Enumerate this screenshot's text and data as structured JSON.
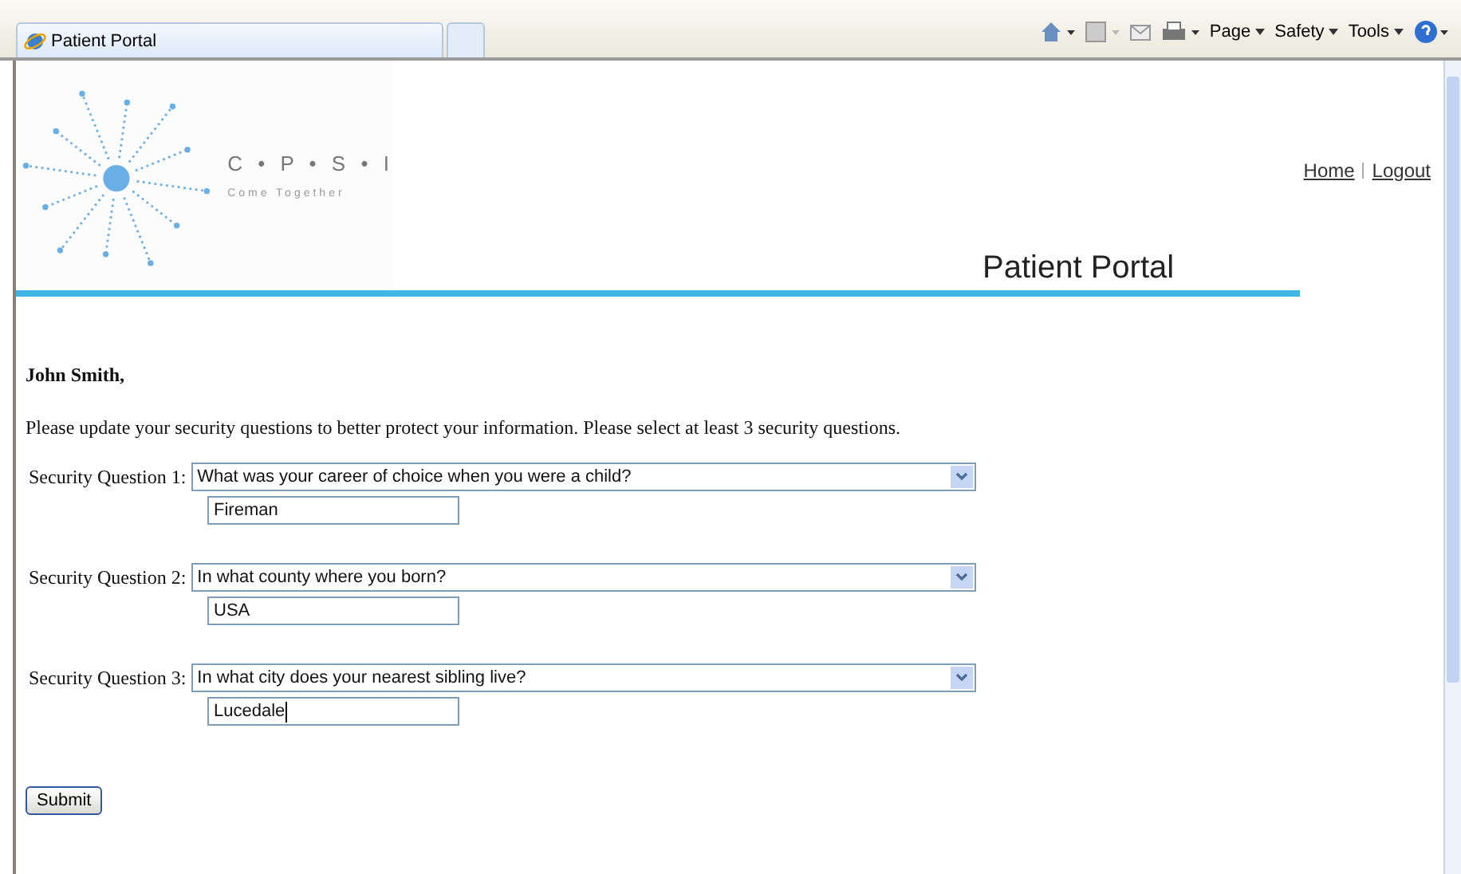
{
  "browser": {
    "tabs": [
      {
        "title": "Patient Portal",
        "selected": true
      },
      {
        "selected": false
      }
    ],
    "toolbar": [
      {
        "kind": "home"
      },
      {
        "kind": "feeds"
      },
      {
        "kind": "mail"
      },
      {
        "kind": "print"
      },
      {
        "kind": "menu",
        "label": "Page"
      },
      {
        "kind": "menu",
        "label": "Safety"
      },
      {
        "kind": "menu",
        "label": "Tools"
      },
      {
        "kind": "help"
      }
    ]
  },
  "logo": {
    "name": "C • P • S • I",
    "tagline": "Come Together"
  },
  "nav": [
    "Home",
    "Logout"
  ],
  "page_title": "Patient Portal",
  "greeting": "John Smith,",
  "intro": "Please update your security questions to better protect your information. Please select at least 3 security questions.",
  "questions": [
    {
      "label": "Security Question 1:",
      "question": "What was your career of choice when you were a child?",
      "answer": "Fireman"
    },
    {
      "label": "Security Question 2:",
      "question": "In what county where you born?",
      "answer": "USA"
    },
    {
      "label": "Security Question 3:",
      "question": "In what city does your nearest sibling live?",
      "answer": "Lucedale"
    }
  ],
  "submit": "Submit"
}
